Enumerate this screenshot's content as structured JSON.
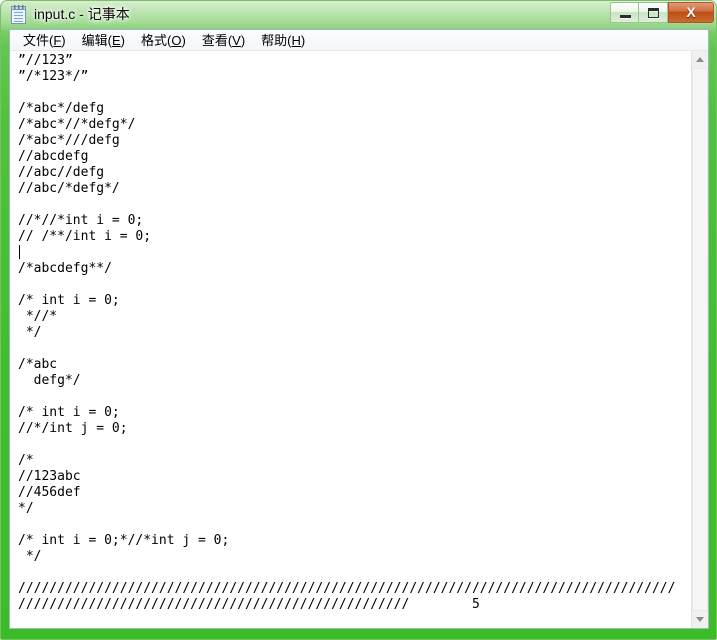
{
  "window": {
    "title": "input.c - 记事本",
    "icon": "notepad-icon",
    "frame_color": "#40bf2d",
    "caption_buttons": [
      {
        "name": "minimize",
        "glyph": "—"
      },
      {
        "name": "maximize-restore",
        "glyph": "❐"
      },
      {
        "name": "close",
        "glyph": "X",
        "color": "#bc4f16"
      }
    ]
  },
  "menubar": {
    "items": [
      {
        "label": "文件",
        "accel": "F"
      },
      {
        "label": "编辑",
        "accel": "E"
      },
      {
        "label": "格式",
        "accel": "O"
      },
      {
        "label": "查看",
        "accel": "V"
      },
      {
        "label": "帮助",
        "accel": "H"
      }
    ]
  },
  "editor": {
    "filename": "input.c",
    "caret_line": 13,
    "lines_before_caret": [
      "”//123”",
      "”/*123*/”",
      "",
      "/*abc*/defg",
      "/*abc*//*defg*/",
      "/*abc*///defg",
      "//abcdefg",
      "//abc//defg",
      "//abc/*defg*/",
      "",
      "//*//*int i = 0;",
      "// /**/int i = 0;"
    ],
    "lines_after_caret": [
      "/*abcdefg**/",
      "",
      "/* int i = 0;",
      " *//*",
      " */",
      "",
      "/*abc",
      "  defg*/",
      "",
      "/* int i = 0;",
      "//*/int j = 0;",
      "",
      "/*",
      "//123abc",
      "//456def",
      "*/",
      "",
      "/* int i = 0;*//*int j = 0;",
      " */",
      "",
      "////////////////////////////////////////////////////////////////////////////////////",
      "//////////////////////////////////////////////////        5"
    ]
  },
  "scrollbar": {
    "orientation": "vertical",
    "up_arrow": "▲",
    "down_arrow": "▼"
  }
}
